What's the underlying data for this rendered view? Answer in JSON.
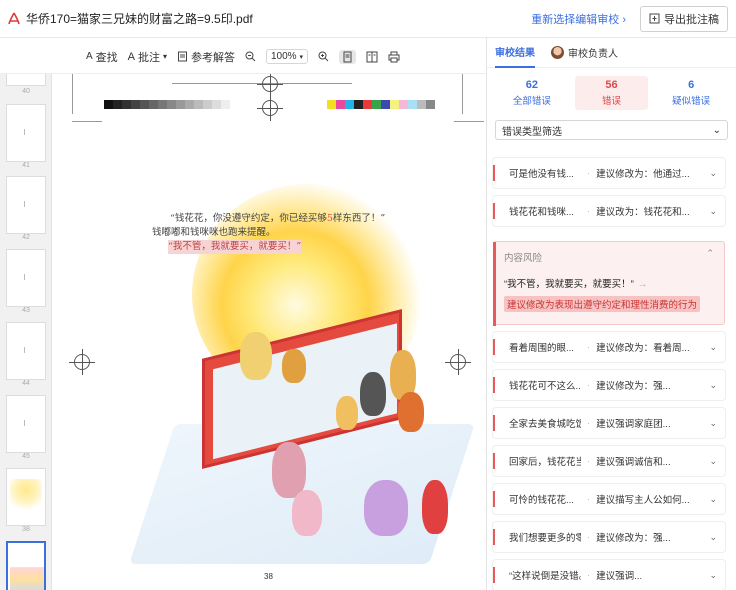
{
  "header": {
    "file_name": "华侨170=猫家三兄妹的财富之路=9.5印.pdf",
    "reselect_label": "重新选择编辑审校",
    "reselect_arrow": "›",
    "export_label": "导出批注稿"
  },
  "toolbar": {
    "find_label": "查找",
    "annotate_label": "批注",
    "reference_label": "参考解答",
    "zoom_value": "100%",
    "find_icon": "A",
    "annotate_icon": "A"
  },
  "thumbnails": {
    "page_numbers": [
      "40",
      "41",
      "42",
      "43",
      "44",
      "45",
      "38"
    ]
  },
  "document": {
    "line1": "“钱花花，你没遵守约定，你已经买够",
    "line1_num": "5",
    "line1_end": "样东西了！”",
    "line2": "钱嘟嘟和钱咪咪也跑来提醒。",
    "line3": "“我不管，我就要买，就要买！”",
    "page_number": "38"
  },
  "panel": {
    "tab_results": "审校结果",
    "tab_owner": "审校负责人",
    "stats": {
      "total_count": "62",
      "total_label": "全部错误",
      "error_count": "56",
      "error_label": "错误",
      "doubt_count": "6",
      "doubt_label": "疑似错误"
    },
    "filter_label": "错误类型筛选",
    "items": [
      {
        "left": "可是他没有钱...",
        "right": "建议修改为：他通过..."
      },
      {
        "left": "钱花花和钱咪...",
        "right": "建议改为：钱花花和..."
      },
      {
        "left": "看着周围的眼...",
        "right": "建议修改为：看着周..."
      },
      {
        "left": "钱花花可不这么...",
        "right": "建议修改为：强..."
      },
      {
        "left": "全家去美食城吃饭...",
        "right": "建议强调家庭团..."
      },
      {
        "left": "回家后，钱花花当...",
        "right": "建议强调诚信和..."
      },
      {
        "left": "可怜的钱花花...",
        "right": "建议描写主人公如何..."
      },
      {
        "left": "我们想要更多的零花...",
        "right": "建议修改为：强..."
      },
      {
        "left": "“这样说倒是没错。大多数...",
        "right": "建议强调..."
      }
    ],
    "expanded": {
      "title": "内容风险",
      "quote": "“我不管，我就要买，就要买！”",
      "arrow": "→",
      "suggestion": "建议修改为表现出遵守约定和理性消费的行为"
    }
  }
}
